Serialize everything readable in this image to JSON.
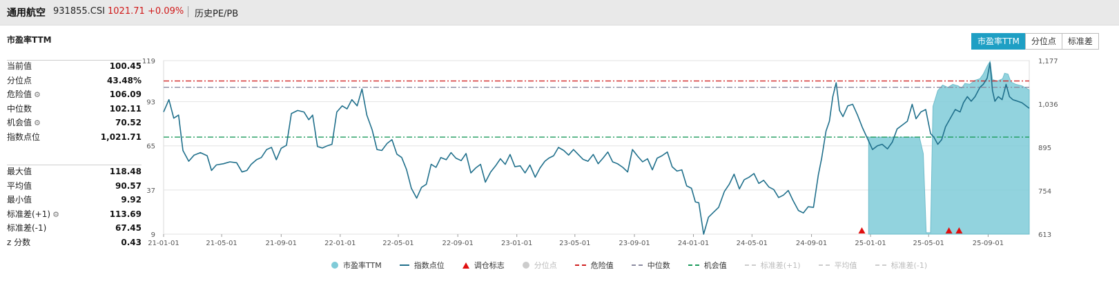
{
  "header": {
    "name": "通用航空",
    "code": "931855.CSI",
    "price": "1021.71",
    "change": "+0.09%",
    "history_link": "历史PE/PB"
  },
  "section_title": "市盈率TTM",
  "tabs": [
    {
      "label": "市盈率TTM",
      "active": true
    },
    {
      "label": "分位点",
      "active": false
    },
    {
      "label": "标准差",
      "active": false
    }
  ],
  "stats_top": [
    {
      "label": "当前值",
      "value": "100.45"
    },
    {
      "label": "分位点",
      "value": "43.48%"
    },
    {
      "label": "危险值",
      "value": "106.09",
      "gear": true
    },
    {
      "label": "中位数",
      "value": "102.11"
    },
    {
      "label": "机会值",
      "value": "70.52",
      "gear": true
    },
    {
      "label": "指数点位",
      "value": "1,021.71"
    }
  ],
  "stats_bottom": [
    {
      "label": "最大值",
      "value": "118.48"
    },
    {
      "label": "平均值",
      "value": "90.57"
    },
    {
      "label": "最小值",
      "value": "9.92"
    },
    {
      "label": "标准差(+1)",
      "value": "113.69",
      "gear": true
    },
    {
      "label": "标准差(-1)",
      "value": "67.45"
    },
    {
      "label": "z 分数",
      "value": "0.43"
    }
  ],
  "legend": [
    {
      "label": "市盈率TTM",
      "kind": "dot",
      "color": "#7fcbd8"
    },
    {
      "label": "指数点位",
      "kind": "line",
      "color": "#1f6f8b"
    },
    {
      "label": "调仓标志",
      "kind": "triangle",
      "color": "#e01010"
    },
    {
      "label": "分位点",
      "kind": "dot",
      "color": "#cccccc",
      "dim": true
    },
    {
      "label": "危险值",
      "kind": "dashdot",
      "color": "#d02020"
    },
    {
      "label": "中位数",
      "kind": "dashdot",
      "color": "#8a8aa0"
    },
    {
      "label": "机会值",
      "kind": "dashdot",
      "color": "#1a9a5a"
    },
    {
      "label": "标准差(+1)",
      "kind": "dashdot",
      "color": "#cccccc",
      "dim": true
    },
    {
      "label": "平均值",
      "kind": "dashdot",
      "color": "#cccccc",
      "dim": true
    },
    {
      "label": "标准差(-1)",
      "kind": "dashdot",
      "color": "#cccccc",
      "dim": true
    }
  ],
  "chart_data": {
    "type": "line",
    "x_ticks": [
      "21-01-01",
      "21-05-01",
      "21-09-01",
      "22-01-01",
      "22-05-01",
      "22-09-01",
      "23-01-01",
      "23-05-01",
      "23-09-01",
      "24-01-01",
      "24-05-01",
      "24-09-01",
      "25-01-01",
      "25-05-01",
      "25-09-01"
    ],
    "y_left_ticks": [
      "9",
      "37",
      "65",
      "93",
      "119"
    ],
    "y_left_range": [
      9,
      119
    ],
    "y_right_ticks": [
      "613",
      "754",
      "895",
      "1,036",
      "1,177"
    ],
    "y_right_range": [
      613,
      1177
    ],
    "x_range": [
      "2021-01-01",
      "2025-11-25"
    ],
    "reference_lines": [
      {
        "name": "危险值",
        "value": 106.09,
        "color": "#d02020"
      },
      {
        "name": "中位数",
        "value": 102.11,
        "color": "#8a8aa0"
      },
      {
        "name": "机会值",
        "value": 70.52,
        "color": "#1a9a5a"
      }
    ],
    "series": [
      {
        "name": "指数点位",
        "axis": "right",
        "color": "#1f6f8b",
        "points": [
          [
            "2021-01-01",
            1010
          ],
          [
            "2021-01-12",
            1050
          ],
          [
            "2021-01-22",
            990
          ],
          [
            "2021-02-01",
            1000
          ],
          [
            "2021-02-10",
            885
          ],
          [
            "2021-02-22",
            850
          ],
          [
            "2021-03-05",
            870
          ],
          [
            "2021-03-18",
            878
          ],
          [
            "2021-04-01",
            868
          ],
          [
            "2021-04-10",
            820
          ],
          [
            "2021-04-20",
            838
          ],
          [
            "2021-05-05",
            842
          ],
          [
            "2021-05-18",
            848
          ],
          [
            "2021-06-01",
            845
          ],
          [
            "2021-06-12",
            815
          ],
          [
            "2021-06-22",
            820
          ],
          [
            "2021-07-01",
            840
          ],
          [
            "2021-07-12",
            855
          ],
          [
            "2021-07-22",
            862
          ],
          [
            "2021-08-02",
            888
          ],
          [
            "2021-08-12",
            895
          ],
          [
            "2021-08-22",
            855
          ],
          [
            "2021-09-01",
            892
          ],
          [
            "2021-09-12",
            902
          ],
          [
            "2021-09-22",
            1005
          ],
          [
            "2021-10-05",
            1015
          ],
          [
            "2021-10-18",
            1010
          ],
          [
            "2021-10-28",
            985
          ],
          [
            "2021-11-05",
            1000
          ],
          [
            "2021-11-15",
            898
          ],
          [
            "2021-11-25",
            893
          ],
          [
            "2021-12-05",
            900
          ],
          [
            "2021-12-15",
            905
          ],
          [
            "2021-12-25",
            1010
          ],
          [
            "2022-01-05",
            1030
          ],
          [
            "2022-01-15",
            1020
          ],
          [
            "2022-01-25",
            1050
          ],
          [
            "2022-02-05",
            1030
          ],
          [
            "2022-02-15",
            1085
          ],
          [
            "2022-02-25",
            1000
          ],
          [
            "2022-03-08",
            952
          ],
          [
            "2022-03-18",
            888
          ],
          [
            "2022-03-28",
            885
          ],
          [
            "2022-04-08",
            908
          ],
          [
            "2022-04-18",
            920
          ],
          [
            "2022-04-28",
            873
          ],
          [
            "2022-05-08",
            862
          ],
          [
            "2022-05-18",
            823
          ],
          [
            "2022-05-28",
            762
          ],
          [
            "2022-06-08",
            730
          ],
          [
            "2022-06-18",
            765
          ],
          [
            "2022-06-28",
            775
          ],
          [
            "2022-07-08",
            840
          ],
          [
            "2022-07-18",
            830
          ],
          [
            "2022-07-28",
            862
          ],
          [
            "2022-08-08",
            855
          ],
          [
            "2022-08-18",
            878
          ],
          [
            "2022-08-28",
            860
          ],
          [
            "2022-09-08",
            852
          ],
          [
            "2022-09-18",
            875
          ],
          [
            "2022-09-28",
            812
          ],
          [
            "2022-10-08",
            828
          ],
          [
            "2022-10-18",
            840
          ],
          [
            "2022-10-28",
            782
          ],
          [
            "2022-11-08",
            815
          ],
          [
            "2022-11-18",
            835
          ],
          [
            "2022-11-28",
            858
          ],
          [
            "2022-12-08",
            840
          ],
          [
            "2022-12-18",
            872
          ],
          [
            "2022-12-28",
            832
          ],
          [
            "2023-01-08",
            835
          ],
          [
            "2023-01-18",
            812
          ],
          [
            "2023-01-28",
            838
          ],
          [
            "2023-02-08",
            798
          ],
          [
            "2023-02-18",
            828
          ],
          [
            "2023-02-28",
            850
          ],
          [
            "2023-03-08",
            860
          ],
          [
            "2023-03-18",
            868
          ],
          [
            "2023-03-28",
            895
          ],
          [
            "2023-04-08",
            885
          ],
          [
            "2023-04-18",
            870
          ],
          [
            "2023-04-28",
            888
          ],
          [
            "2023-05-08",
            872
          ],
          [
            "2023-05-18",
            856
          ],
          [
            "2023-05-28",
            850
          ],
          [
            "2023-06-08",
            872
          ],
          [
            "2023-06-18",
            842
          ],
          [
            "2023-06-28",
            860
          ],
          [
            "2023-07-08",
            880
          ],
          [
            "2023-07-18",
            848
          ],
          [
            "2023-07-28",
            842
          ],
          [
            "2023-08-08",
            830
          ],
          [
            "2023-08-18",
            815
          ],
          [
            "2023-08-28",
            888
          ],
          [
            "2023-09-08",
            866
          ],
          [
            "2023-09-18",
            848
          ],
          [
            "2023-09-28",
            858
          ],
          [
            "2023-10-08",
            822
          ],
          [
            "2023-10-18",
            860
          ],
          [
            "2023-10-28",
            868
          ],
          [
            "2023-11-08",
            880
          ],
          [
            "2023-11-18",
            832
          ],
          [
            "2023-11-28",
            818
          ],
          [
            "2023-12-08",
            822
          ],
          [
            "2023-12-18",
            770
          ],
          [
            "2023-12-28",
            762
          ],
          [
            "2024-01-05",
            718
          ],
          [
            "2024-01-12",
            715
          ],
          [
            "2024-01-22",
            613
          ],
          [
            "2024-02-01",
            668
          ],
          [
            "2024-02-12",
            685
          ],
          [
            "2024-02-22",
            700
          ],
          [
            "2024-03-05",
            752
          ],
          [
            "2024-03-15",
            775
          ],
          [
            "2024-03-25",
            808
          ],
          [
            "2024-04-05",
            760
          ],
          [
            "2024-04-15",
            790
          ],
          [
            "2024-04-25",
            798
          ],
          [
            "2024-05-05",
            810
          ],
          [
            "2024-05-15",
            778
          ],
          [
            "2024-05-25",
            788
          ],
          [
            "2024-06-05",
            766
          ],
          [
            "2024-06-15",
            758
          ],
          [
            "2024-06-25",
            732
          ],
          [
            "2024-07-05",
            740
          ],
          [
            "2024-07-15",
            755
          ],
          [
            "2024-07-25",
            722
          ],
          [
            "2024-08-05",
            690
          ],
          [
            "2024-08-15",
            682
          ],
          [
            "2024-08-25",
            702
          ],
          [
            "2024-09-05",
            700
          ],
          [
            "2024-09-15",
            805
          ],
          [
            "2024-09-22",
            860
          ],
          [
            "2024-10-01",
            948
          ],
          [
            "2024-10-08",
            980
          ],
          [
            "2024-10-15",
            1060
          ],
          [
            "2024-10-22",
            1105
          ],
          [
            "2024-10-29",
            1015
          ],
          [
            "2024-11-05",
            995
          ],
          [
            "2024-11-15",
            1030
          ],
          [
            "2024-11-25",
            1035
          ],
          [
            "2024-12-05",
            1000
          ],
          [
            "2024-12-15",
            960
          ],
          [
            "2025-01-05",
            888
          ],
          [
            "2025-01-15",
            900
          ],
          [
            "2025-01-25",
            905
          ],
          [
            "2025-02-05",
            890
          ],
          [
            "2025-02-15",
            912
          ],
          [
            "2025-02-25",
            955
          ],
          [
            "2025-03-08",
            968
          ],
          [
            "2025-03-18",
            980
          ],
          [
            "2025-03-28",
            1035
          ],
          [
            "2025-04-05",
            988
          ],
          [
            "2025-04-15",
            1010
          ],
          [
            "2025-04-25",
            1018
          ],
          [
            "2025-05-05",
            940
          ],
          [
            "2025-05-12",
            928
          ],
          [
            "2025-05-20",
            905
          ],
          [
            "2025-05-28",
            920
          ],
          [
            "2025-06-05",
            962
          ],
          [
            "2025-06-15",
            990
          ],
          [
            "2025-06-25",
            1018
          ],
          [
            "2025-07-05",
            1010
          ],
          [
            "2025-07-12",
            1040
          ],
          [
            "2025-07-20",
            1060
          ],
          [
            "2025-07-28",
            1045
          ],
          [
            "2025-08-05",
            1060
          ],
          [
            "2025-08-15",
            1090
          ],
          [
            "2025-08-22",
            1100
          ],
          [
            "2025-08-30",
            1120
          ],
          [
            "2025-09-05",
            1170
          ],
          [
            "2025-09-10",
            1080
          ],
          [
            "2025-09-15",
            1045
          ],
          [
            "2025-09-22",
            1060
          ],
          [
            "2025-09-30",
            1050
          ],
          [
            "2025-10-08",
            1100
          ],
          [
            "2025-10-15",
            1060
          ],
          [
            "2025-10-22",
            1050
          ],
          [
            "2025-11-01",
            1045
          ],
          [
            "2025-11-10",
            1040
          ],
          [
            "2025-11-25",
            1022
          ]
        ]
      },
      {
        "name": "市盈率TTM",
        "axis": "left",
        "color": "#7fcbd8",
        "points": [
          [
            "2024-12-28",
            70.5
          ],
          [
            "2025-04-12",
            70.5
          ],
          [
            "2025-04-20",
            60.0
          ],
          [
            "2025-04-26",
            9.9
          ],
          [
            "2025-05-05",
            9.9
          ],
          [
            "2025-05-10",
            90.0
          ],
          [
            "2025-05-20",
            100.0
          ],
          [
            "2025-05-30",
            103.5
          ],
          [
            "2025-06-10",
            102.0
          ],
          [
            "2025-06-20",
            104.0
          ],
          [
            "2025-07-01",
            103.0
          ],
          [
            "2025-07-08",
            101.5
          ],
          [
            "2025-07-15",
            104.5
          ],
          [
            "2025-07-25",
            104.0
          ],
          [
            "2025-08-05",
            106.5
          ],
          [
            "2025-08-15",
            107.5
          ],
          [
            "2025-08-22",
            110.5
          ],
          [
            "2025-08-30",
            115.5
          ],
          [
            "2025-09-05",
            118.5
          ],
          [
            "2025-09-10",
            107.0
          ],
          [
            "2025-09-20",
            106.0
          ],
          [
            "2025-10-01",
            107.5
          ],
          [
            "2025-10-05",
            111.0
          ],
          [
            "2025-10-12",
            110.5
          ],
          [
            "2025-10-18",
            105.5
          ],
          [
            "2025-10-28",
            104.0
          ],
          [
            "2025-11-10",
            103.0
          ],
          [
            "2025-11-25",
            100.45
          ]
        ]
      }
    ],
    "markers": {
      "name": "调仓标志",
      "dates": [
        "2024-12-14",
        "2025-06-12",
        "2025-07-03"
      ],
      "color": "#e01010"
    }
  }
}
